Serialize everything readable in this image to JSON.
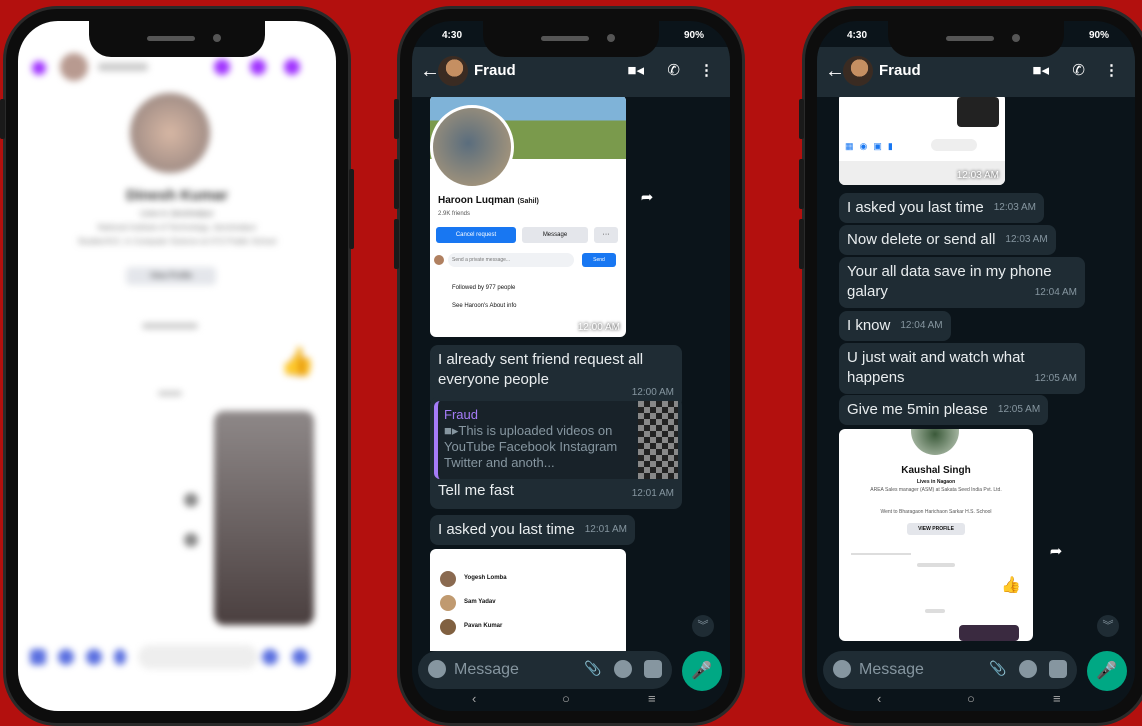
{
  "phone1": {
    "contact_name": "Dinesh Kumar",
    "subtitle": "Lives in Jamshedpur",
    "detail_line1": "National Institute of Technology, Jamshedpur",
    "detail_line2": "Studied B.E. in Computer Science at XYZ Public School",
    "button": "View Profile"
  },
  "phone2": {
    "status_time": "4:30",
    "status_battery": "90%",
    "contact": "Fraud",
    "profile_card": {
      "name": "Haroon Luqman",
      "name_suffix": "(Sahil)",
      "friends": "2.9K friends",
      "cancel_btn": "Cancel request",
      "message_btn": "Message",
      "more_btn": "···",
      "private_placeholder": "Send a private message...",
      "send_btn": "Send",
      "followed": "Followed by 977 people",
      "about": "See Haroon's About info",
      "time": "12:00 AM"
    },
    "messages": [
      {
        "text": "I already sent friend request all everyone people",
        "time": "12:00 AM"
      },
      {
        "quote_author": "Fraud",
        "quote_text": "This is uploaded videos on YouTube Facebook Instagram Twitter and anoth...",
        "text": "Tell me fast",
        "time": "12:01 AM"
      },
      {
        "text": "I asked you last time",
        "time": "12:01 AM"
      }
    ],
    "friend_list": [
      "Yogesh Lomba",
      "Sam Yadav",
      "Pavan Kumar"
    ],
    "input_placeholder": "Message"
  },
  "phone3": {
    "status_time": "4:30",
    "status_battery": "90%",
    "contact": "Fraud",
    "top_image_time": "12:03 AM",
    "messages": [
      {
        "text": "I asked you last time",
        "time": "12:03 AM"
      },
      {
        "text": "Now delete or send all",
        "time": "12:03 AM"
      },
      {
        "text": "Your all data save in my phone galary",
        "time": "12:04 AM"
      },
      {
        "text": "I know",
        "time": "12:04 AM"
      },
      {
        "text": "U just wait and watch what happens",
        "time": "12:05 AM"
      },
      {
        "text": "Give me 5min please",
        "time": "12:05 AM"
      }
    ],
    "card": {
      "name": "Kaushal Singh",
      "lives": "Lives in Nagaon",
      "detail": "AREA Sales manager (ASM) at Sakata Seed India Pvt. Ltd.",
      "school": "Went to Bharagaon Harichaon Sarkar H.S. School",
      "button": "VIEW PROFILE"
    },
    "input_placeholder": "Message"
  }
}
